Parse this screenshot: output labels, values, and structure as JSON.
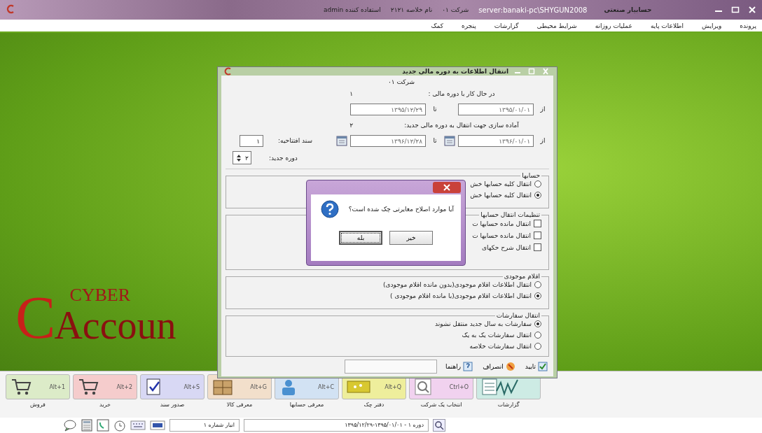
{
  "title_bar": {
    "app_title": "حسابیار صنعتی",
    "server": "server:banaki-pc\\SHYGUN2008",
    "segments": [
      {
        "label": "شرکت",
        "value": "۰۱"
      },
      {
        "label": "نام خلاصه",
        "value": "۲۱۲۱"
      },
      {
        "label": "استفاده کننده",
        "value": "admin"
      }
    ]
  },
  "menu": [
    "پرونده",
    "ویرایش",
    "اطلاعات پایه",
    "عملیات روزانه",
    "شرایط محیطی",
    "گزارشات",
    "پنجره",
    "کمک"
  ],
  "logo": {
    "initial": "C",
    "top": "CYBER",
    "bottom": "Accoun"
  },
  "dialog": {
    "title": "انتقال اطلاعات به دوره مالی جدید",
    "company": "شرکت ۰۱",
    "current": {
      "caption": "در حال کار با دوره مالی :",
      "number": "۱",
      "from_label": "از",
      "from": "۱۳۹۵/۰۱/۰۱",
      "to_label": "تا",
      "to": "۱۳۹۵/۱۲/۲۹"
    },
    "next": {
      "caption": "آماده سازی جهت انتقال به دوره مالی جدید:",
      "number": "۲",
      "from_label": "از",
      "from": "۱۳۹۶/۰۱/۰۱",
      "to_label": "تا",
      "to": "۱۳۹۶/۱۲/۲۸"
    },
    "opening_doc": {
      "label": "سند افتتاحیه:",
      "value": "۱"
    },
    "new_period": {
      "label": "دوره جدید:",
      "value": "۲"
    },
    "groups": [
      {
        "title": "حسابها",
        "kind": "radio",
        "options": [
          {
            "label": "انتقال کلیه حسابها خش",
            "selected": false
          },
          {
            "label": "انتقال کلیه حسابها خش",
            "selected": true
          }
        ]
      },
      {
        "title": "تنظیمات انتقال حسابها",
        "kind": "checkbox",
        "options": [
          {
            "label": "انتقال مانده حسابها ت",
            "checked": false
          },
          {
            "label": "انتقال مانده حسابها ت",
            "checked": false
          },
          {
            "label": "انتقال شرح حکهای",
            "checked": false
          }
        ]
      },
      {
        "title": "اقلام موجودی",
        "kind": "radio",
        "options": [
          {
            "label": "انتقال اطلاعات اقلام موجودی(بدون مانده اقلام موجودی)",
            "selected": false
          },
          {
            "label": "انتقال اطلاعات اقلام موجودی(با مانده اقلام موجودی )",
            "selected": true
          }
        ]
      },
      {
        "title": "انتقال سفارشات",
        "kind": "radio",
        "options": [
          {
            "label": "سفارشات به سال جدید منتقل نشوند",
            "selected": true
          },
          {
            "label": "انتقال سفارشات یک به یک",
            "selected": false
          },
          {
            "label": "انتقال سفارشات خلاصه",
            "selected": false
          }
        ]
      }
    ],
    "buttons": [
      {
        "label": "تایید",
        "kind": "ok"
      },
      {
        "label": "انصراف",
        "kind": "cancel"
      },
      {
        "label": "راهنما",
        "kind": "help"
      }
    ]
  },
  "message_box": {
    "text": "آیا موارد اصلاح مغایرتی چک شده است؟",
    "buttons": [
      {
        "label": "خیر",
        "selected": false
      },
      {
        "label": "بله",
        "selected": true
      }
    ]
  },
  "toolbar": [
    {
      "label": "گزارشات",
      "kind": "chart",
      "color": "#cdebe4"
    },
    {
      "label": "انتخاب یک شرکت",
      "shortcut": "Ctrl+O",
      "kind": "search",
      "color": "#f1d2ef"
    },
    {
      "label": "دفتر چک",
      "shortcut": "Alt+Q",
      "kind": "cheque",
      "color": "#eeee9c"
    },
    {
      "label": "معرفی حسابها",
      "shortcut": "Alt+C",
      "kind": "person",
      "color": "#d2e2f3"
    },
    {
      "label": "معرفی کالا",
      "shortcut": "Alt+G",
      "kind": "boxes",
      "color": "#f2dfcb"
    },
    {
      "label": "صدور سند",
      "shortcut": "Alt+S",
      "kind": "document",
      "color": "#d8d8f4"
    },
    {
      "label": "خرید",
      "shortcut": "Alt+2",
      "kind": "cart",
      "color": "#f5cccc"
    },
    {
      "label": "فروش",
      "shortcut": "Alt+1",
      "kind": "cart",
      "color": "#dcebc8"
    }
  ],
  "status_bar": {
    "warehouse": "انبار شماره ۱",
    "period": "دوره ۱ - ۱۳۹۵/۰۱/۰۱-۱۳۹۵/۱۲/۲۹"
  }
}
